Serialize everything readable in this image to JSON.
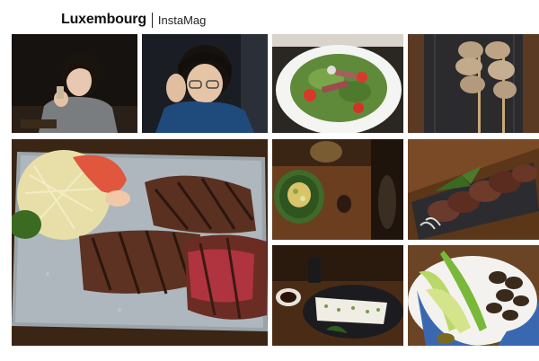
{
  "header": {
    "title": "Luxembourg",
    "subtitle": "InstaMag"
  },
  "photos": [
    {
      "subject": "woman-holding-glass"
    },
    {
      "subject": "man-with-glasses"
    },
    {
      "subject": "beef-salad"
    },
    {
      "subject": "yakitori-skewers"
    },
    {
      "subject": "grilled-steak-platter"
    },
    {
      "subject": "pickled-side-dish"
    },
    {
      "subject": "sliced-seared-beef"
    },
    {
      "subject": "tofu-plate"
    },
    {
      "subject": "vegetables-and-grilled-meat"
    }
  ]
}
